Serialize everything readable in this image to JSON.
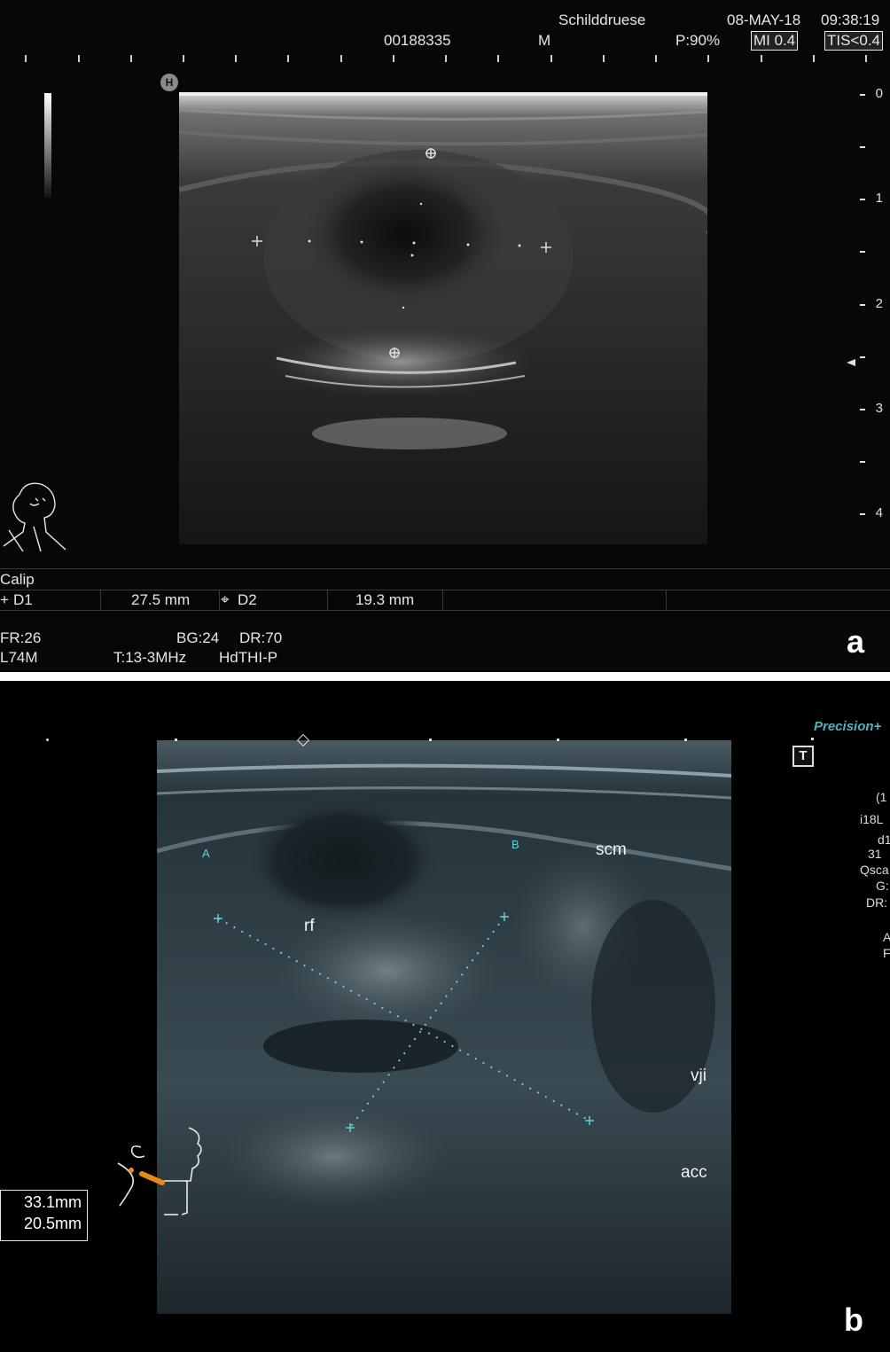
{
  "panel_a": {
    "header": {
      "exam": "Schilddruese",
      "date": "08-MAY-18",
      "time": "09:38:19",
      "patient_id": "00188335",
      "m": "M",
      "power": "P:90%",
      "mi": "MI 0.4",
      "tis": "TIS<0.4"
    },
    "depth_labels": [
      "0",
      "1",
      "2",
      "3",
      "4"
    ],
    "h_marker": "H",
    "calip": {
      "title": "Calip",
      "d1_label": "D1",
      "d1_value": "27.5 mm",
      "d2_label": "D2",
      "d2_value": "19.3 mm"
    },
    "footer": {
      "fr": "FR:26",
      "bg": "BG:24",
      "dr": "DR:70",
      "probe": "L74M",
      "freq": "T:13-3MHz",
      "mode": "HdTHI-P"
    },
    "letter": "a"
  },
  "panel_b": {
    "brand": "Precision+",
    "t_marker": "T",
    "side_info": [
      "(1",
      "i18L",
      "d1",
      "31",
      "Qsca",
      "G:",
      "DR:",
      "A",
      "F"
    ],
    "labels": {
      "a": "A",
      "b": "B",
      "scm": "scm",
      "rf": "rf",
      "vji": "vji",
      "acc": "acc"
    },
    "measurements": [
      "33.1mm",
      "20.5mm"
    ],
    "letter": "b"
  },
  "colors": {
    "caliper_cyan": "#5fd0d6",
    "probe_orange": "#e88a1a"
  }
}
